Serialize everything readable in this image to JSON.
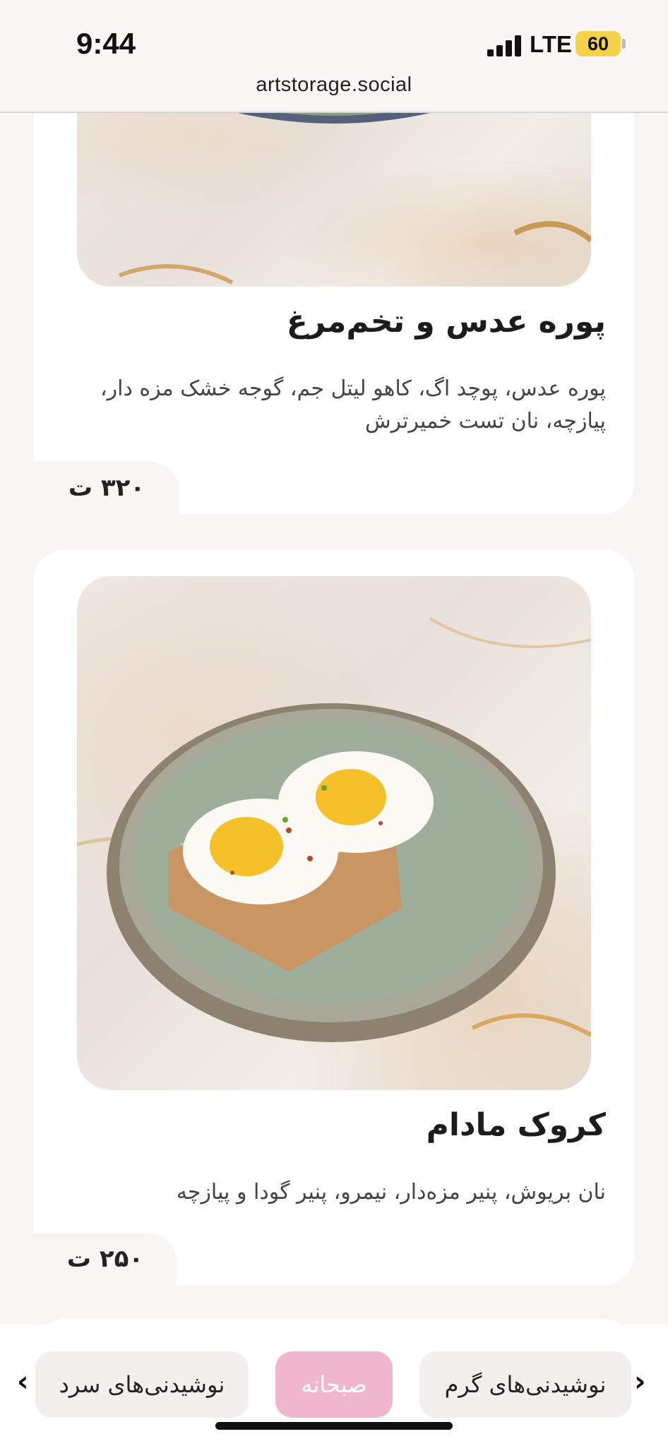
{
  "status": {
    "time": "9:44",
    "network": "LTE",
    "battery": "60"
  },
  "browser": {
    "url": "artstorage.social"
  },
  "items": [
    {
      "title": "پوره عدس و تخم‌مرغ",
      "description": "پوره عدس، پوچد اگ، کاهو لیتل جم، گوجه خشک مزه دار، پیازچه، نان تست خمیرترش",
      "price": "۳۲۰ ت"
    },
    {
      "title": "کروک مادام",
      "description": "نان بریوش، پنیر مزه‌دار، نیمرو، پنیر گودا و پیازچه",
      "price": "۲۵۰ ت"
    }
  ],
  "categories": {
    "left": "نوشیدنی‌های سرد",
    "active": "صبحانه",
    "right": "نوشیدنی‌های گرم",
    "prev_icon": "chevron-left-icon",
    "next_icon": "chevron-right-icon"
  },
  "colors": {
    "active_chip": "#f0b6cd",
    "chip": "#f1f0ef",
    "background": "#faf5f5"
  }
}
